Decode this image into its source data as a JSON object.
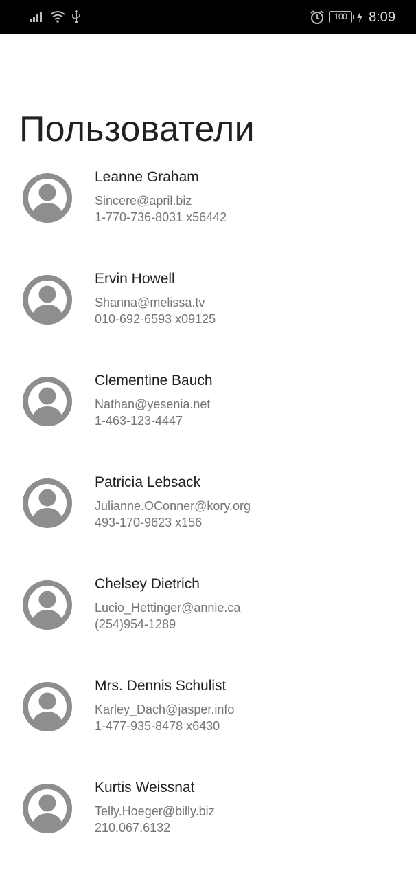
{
  "status_bar": {
    "time": "8:09",
    "battery": "100",
    "icons": [
      "signal-icon",
      "wifi-icon",
      "usb-icon",
      "alarm-icon",
      "battery-icon",
      "charging-icon"
    ]
  },
  "page": {
    "title": "Пользователи"
  },
  "users": [
    {
      "name": "Leanne Graham",
      "email": "Sincere@april.biz",
      "phone": "1-770-736-8031 x56442"
    },
    {
      "name": "Ervin Howell",
      "email": "Shanna@melissa.tv",
      "phone": "010-692-6593 x09125"
    },
    {
      "name": "Clementine Bauch",
      "email": "Nathan@yesenia.net",
      "phone": "1-463-123-4447"
    },
    {
      "name": "Patricia Lebsack",
      "email": "Julianne.OConner@kory.org",
      "phone": "493-170-9623 x156"
    },
    {
      "name": "Chelsey Dietrich",
      "email": "Lucio_Hettinger@annie.ca",
      "phone": "(254)954-1289"
    },
    {
      "name": "Mrs. Dennis Schulist",
      "email": "Karley_Dach@jasper.info",
      "phone": "1-477-935-8478 x6430"
    },
    {
      "name": "Kurtis Weissnat",
      "email": "Telly.Hoeger@billy.biz",
      "phone": "210.067.6132"
    }
  ],
  "colors": {
    "avatar": "#8e8e8e",
    "name_text": "#212121",
    "secondary_text": "#757575",
    "status_bar_bg": "#000000"
  }
}
